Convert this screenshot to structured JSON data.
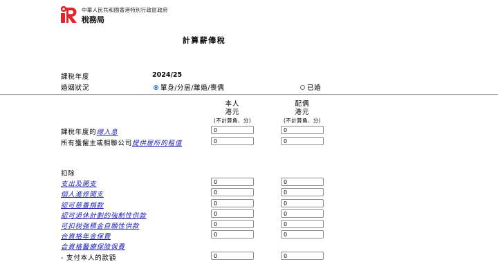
{
  "header": {
    "gov_name": "中華人民共和國香港特別行政區政府",
    "dept_name": "稅務局"
  },
  "page_title": "計算薪俸稅",
  "year": {
    "label": "課稅年度",
    "value": "2024/25"
  },
  "marital": {
    "label": "婚姻狀況",
    "options": [
      {
        "label": "單身/分居/離婚/喪偶",
        "selected": true
      },
      {
        "label": "已婚",
        "selected": false
      }
    ]
  },
  "columns": [
    {
      "title": "本人",
      "unit": "港元",
      "note": "(不計算角、分)"
    },
    {
      "title": "配偶",
      "unit": "港元",
      "note": "(不計算角、分)"
    }
  ],
  "income_rows": [
    {
      "prefix": "課稅年度的",
      "link": "總入息",
      "self": "0",
      "spouse": "0"
    },
    {
      "prefix": "所有獲僱主或相聯公司",
      "link": "提供居所的租值",
      "self": "0",
      "spouse": "0"
    }
  ],
  "deductions_label": "扣除",
  "deduction_rows": [
    {
      "link": "支出及開支",
      "self": "0",
      "spouse": "0"
    },
    {
      "link": "個人進修開支",
      "self": "0",
      "spouse": "0"
    },
    {
      "link": "認可慈善捐款",
      "self": "0",
      "spouse": "0"
    },
    {
      "link": "認可退休計劃的強制性供款",
      "self": "0",
      "spouse": "0"
    },
    {
      "link": "可扣稅強積金自願性供款",
      "self": "0",
      "spouse": "0"
    },
    {
      "link": "合資格年金保費",
      "self": "0",
      "spouse": "0"
    },
    {
      "link": "合資格醫療保險保費"
    },
    {
      "text": "-  支付本人的款額",
      "self": "0",
      "spouse": "0"
    }
  ],
  "colors": {
    "logo_red": "#e0262b",
    "link_blue": "#1a1ab8",
    "radio_blue": "#1a6fd6"
  }
}
